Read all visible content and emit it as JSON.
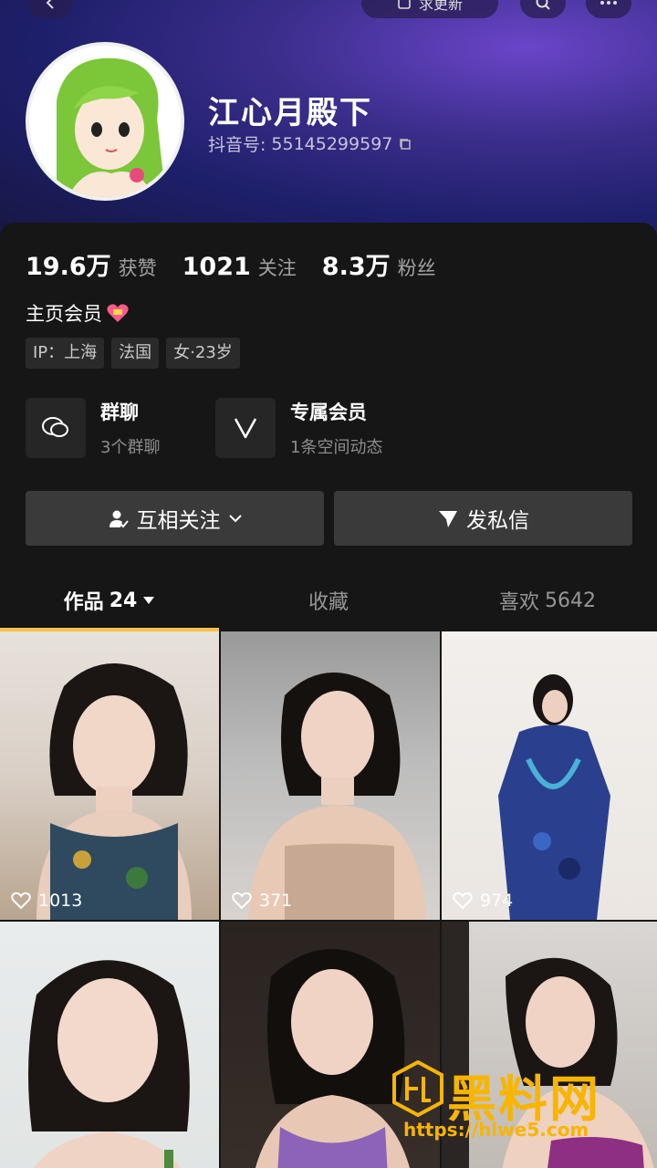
{
  "header": {
    "update_label": "求更新"
  },
  "profile": {
    "name": "江心月殿下",
    "douyin_id_label": "抖音号:",
    "douyin_id": "55145299597"
  },
  "stats": [
    {
      "value": "19.6万",
      "label": "获赞"
    },
    {
      "value": "1021",
      "label": "关注"
    },
    {
      "value": "8.3万",
      "label": "粉丝"
    }
  ],
  "member_text": "主页会员",
  "tags": [
    "IP：上海",
    "法国",
    "女·23岁"
  ],
  "features": [
    {
      "title": "群聊",
      "subtitle": "3个群聊",
      "icon": "chat-bubble-icon"
    },
    {
      "title": "专属会员",
      "subtitle": "1条空间动态",
      "icon": "v-member-icon"
    }
  ],
  "actions": {
    "follow_label": "互相关注",
    "message_label": "发私信"
  },
  "tabs": [
    {
      "label": "作品",
      "count": "24"
    },
    {
      "label": "收藏",
      "count": ""
    },
    {
      "label": "喜欢",
      "count": "5642"
    }
  ],
  "videos": [
    {
      "likes": "1013"
    },
    {
      "likes": "371"
    },
    {
      "likes": "974"
    },
    {
      "likes": ""
    },
    {
      "likes": ""
    },
    {
      "likes": ""
    }
  ],
  "watermark": {
    "title": "黑料网",
    "url": "https://hlwe5.com"
  },
  "colors": {
    "accent_tab_underline": "#f5c34a",
    "header_gradient": "#3a2d8a",
    "watermark": "#f7b500"
  }
}
